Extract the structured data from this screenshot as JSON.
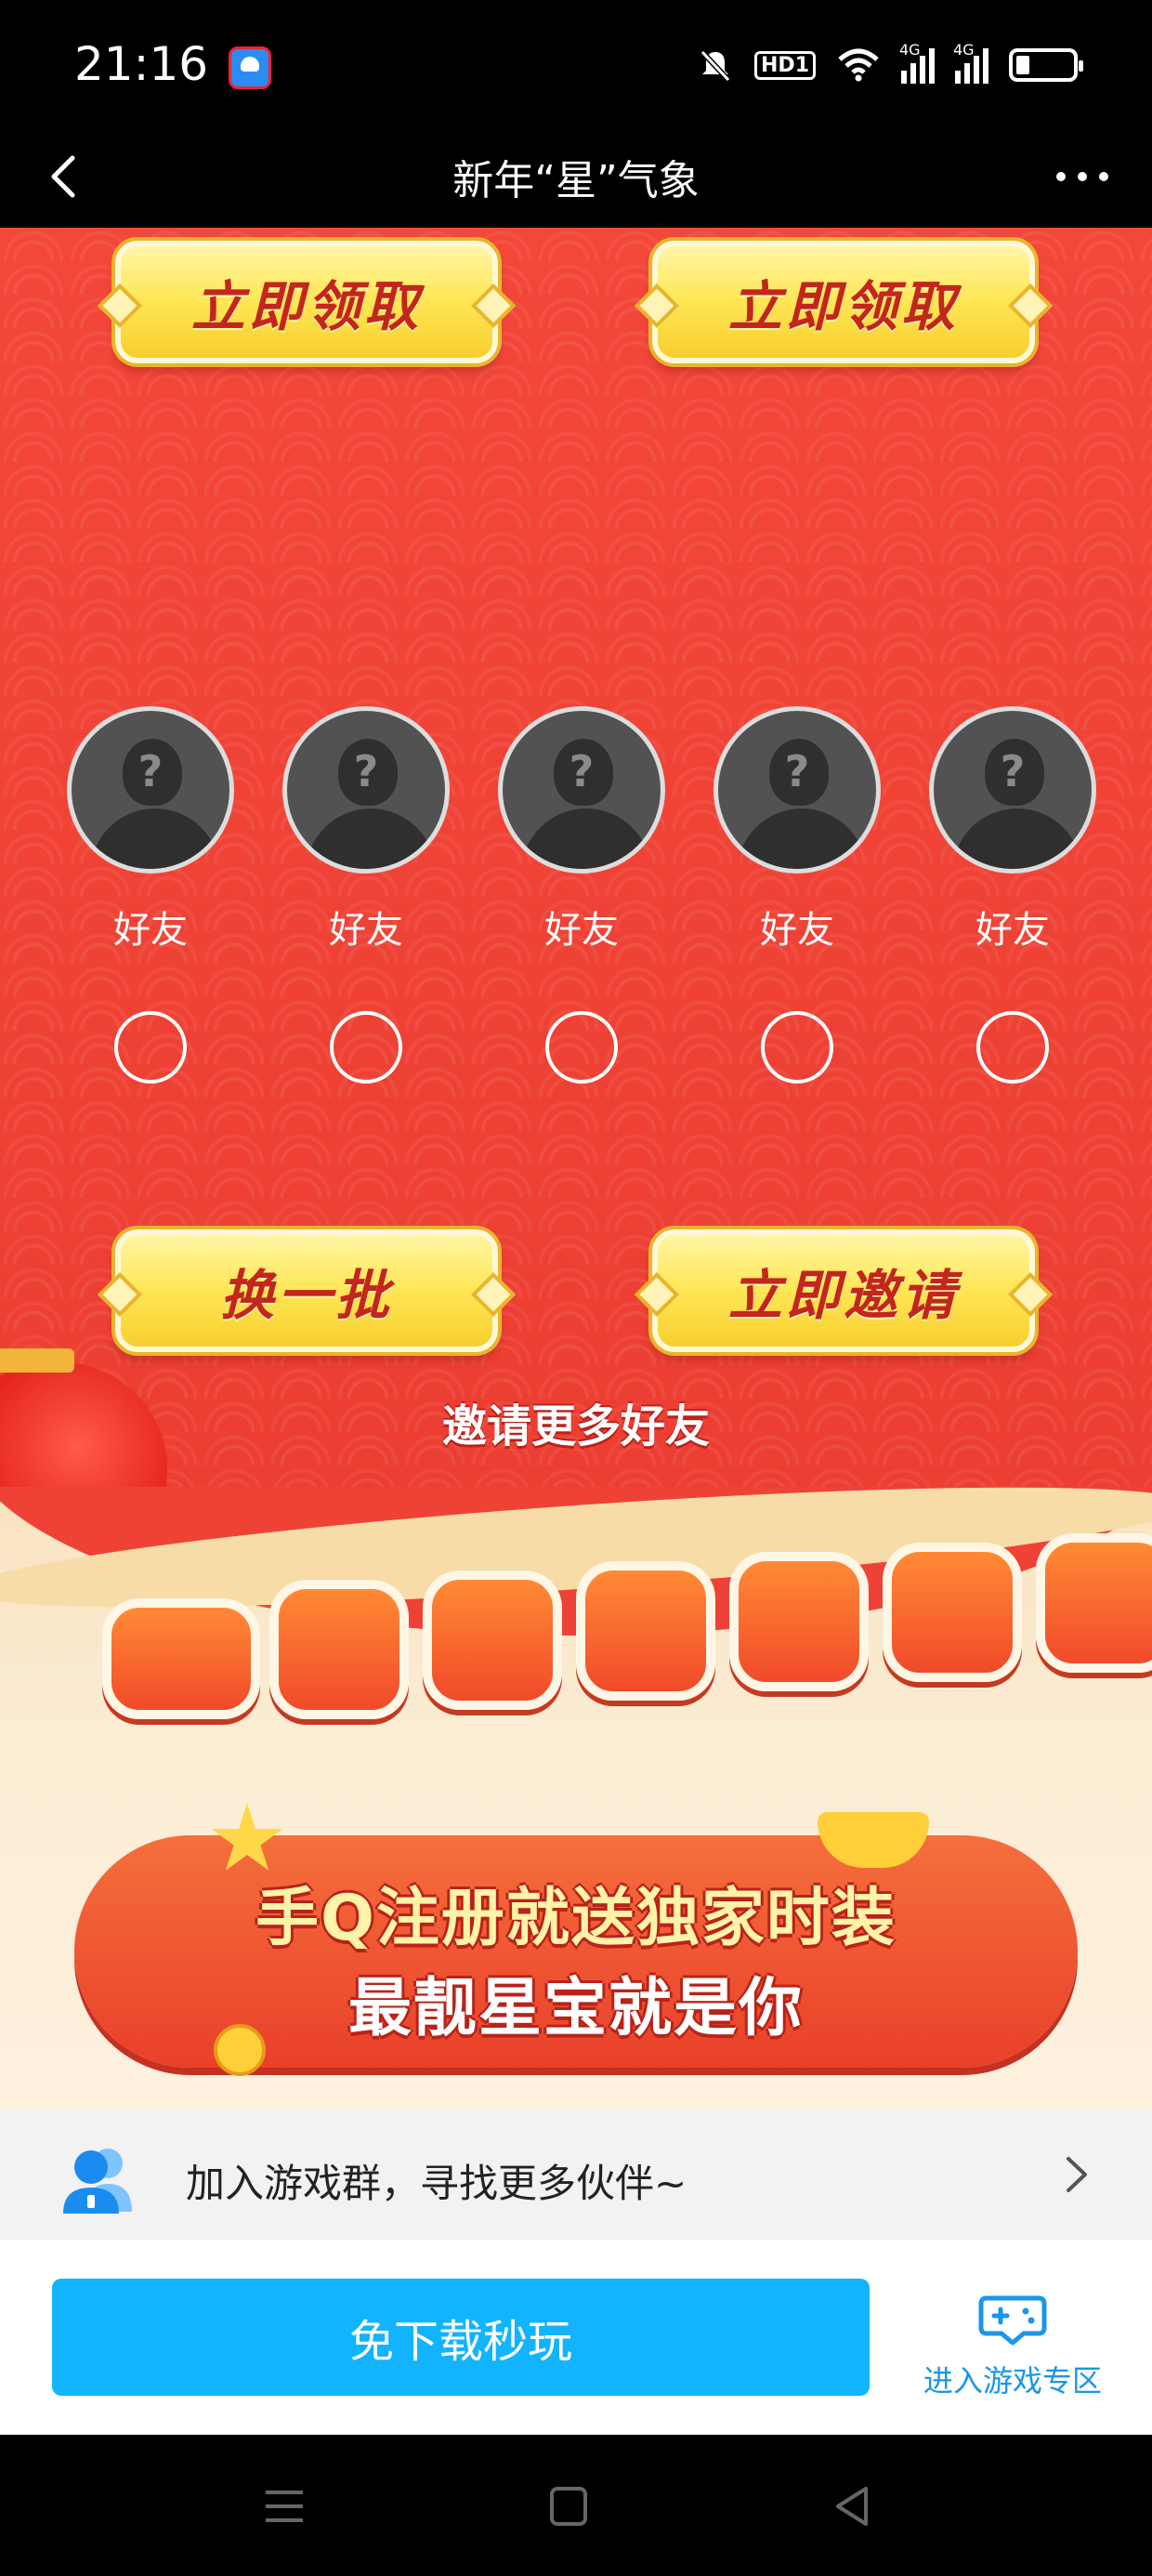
{
  "status_bar": {
    "time": "21:16",
    "hd_label": "HD1",
    "network_1": "4G",
    "network_2": "4G",
    "icons": [
      "app-icon",
      "mute-icon",
      "hd-icon",
      "wifi-icon",
      "signal-icon",
      "signal-icon",
      "battery-icon"
    ]
  },
  "nav": {
    "title": "新年“星”气象",
    "back_icon": "chevron-left-icon",
    "more_icon": "more-dots-icon"
  },
  "event": {
    "claim_buttons": [
      "立即领取",
      "立即领取"
    ],
    "friends": [
      {
        "label": "好友"
      },
      {
        "label": "好友"
      },
      {
        "label": "好友"
      },
      {
        "label": "好友"
      },
      {
        "label": "好友"
      }
    ],
    "refresh_label": "换一批",
    "invite_label": "立即邀请",
    "invite_more": "邀请更多好友"
  },
  "promo": {
    "line1": "手Q注册就送独家时装",
    "line2": "最靓星宝就是你"
  },
  "group_row": {
    "text": "加入游戏群，寻找更多伙伴~"
  },
  "action_bar": {
    "play_label": "免下载秒玩",
    "zone_label": "进入游戏专区"
  },
  "colors": {
    "event_red": "#ef4236",
    "button_gold": "#ffe85a",
    "play_blue": "#12b3ff",
    "link_blue": "#1a96ea"
  }
}
